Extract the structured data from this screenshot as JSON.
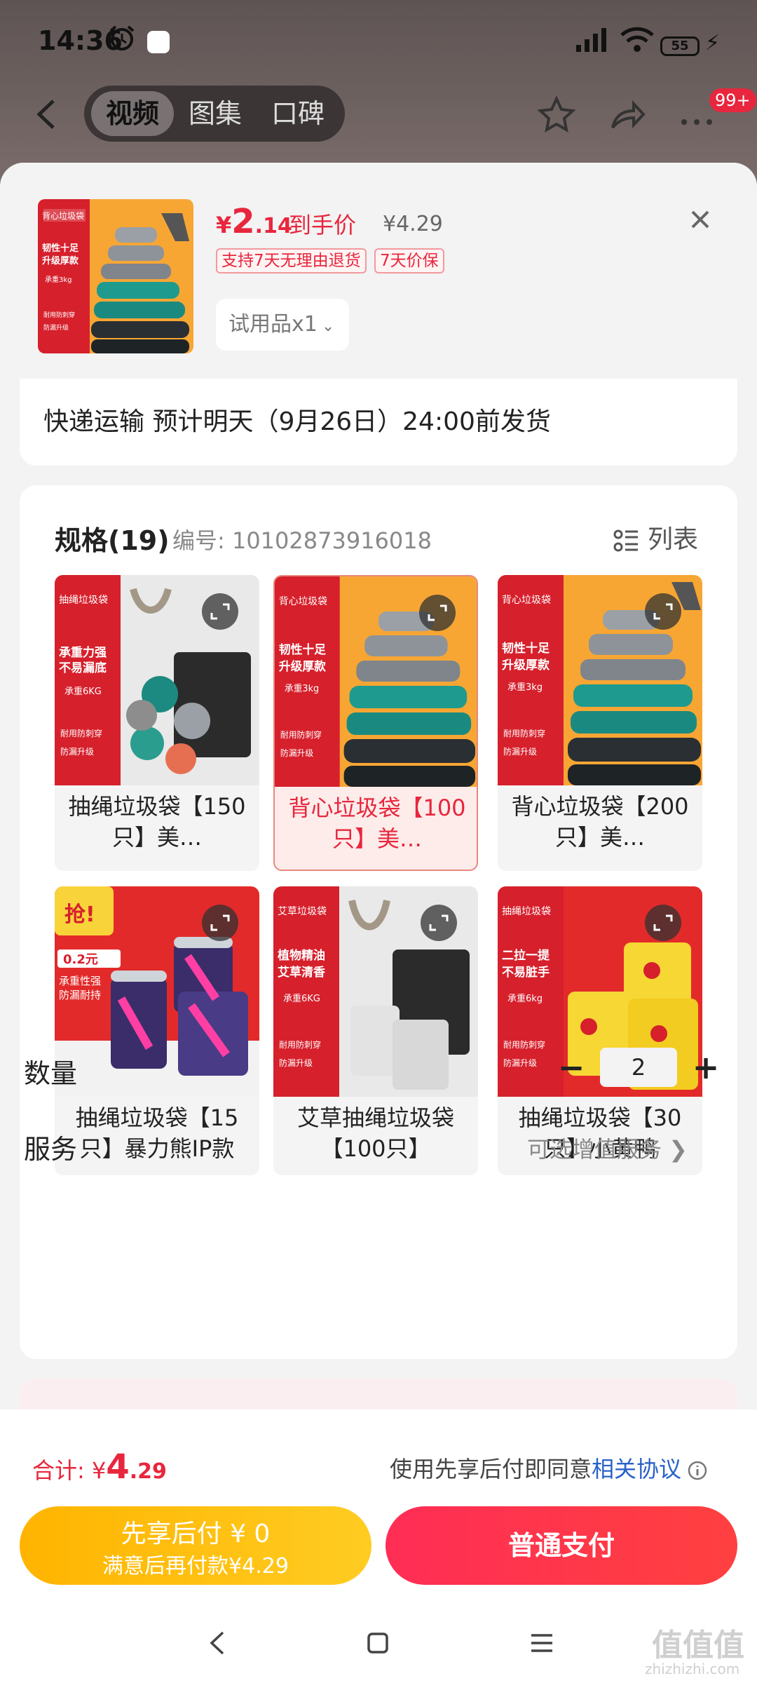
{
  "status_bar": {
    "time": "14:36",
    "battery": "55"
  },
  "top_nav": {
    "tabs": [
      {
        "label": "视频",
        "active": true
      },
      {
        "label": "图集",
        "active": false
      },
      {
        "label": "口碑",
        "active": false
      }
    ],
    "badge": "99+"
  },
  "product": {
    "currency": "¥",
    "price_int": "2",
    "price_dec": ".14",
    "price_label": "到手价",
    "original_price": "¥4.29",
    "tags": [
      "支持7天无理由退货",
      "7天价保"
    ],
    "selected_option": "试用品x1",
    "thumb_text": {
      "top": "背心垃圾袋",
      "mid": "韧性十足\n升级厚款",
      "sub": "承重3kg",
      "f1": "耐用防刺穿",
      "f2": "防漏升级"
    }
  },
  "shipping": {
    "text": "快递运输 预计明天（9月26日）24:00前发货"
  },
  "specs": {
    "title": "规格(19)",
    "code": "编号: 10102873916018",
    "list_label": "列表",
    "items": [
      {
        "caption": "抽绳垃圾袋【150只】美…",
        "banner": "抽绳垃圾袋",
        "headline": "承重力强\n不易漏底",
        "sub": "承重6KG",
        "f1": "耐用防刺穿",
        "f2": "防漏升级",
        "selected": false
      },
      {
        "caption": "背心垃圾袋【100只】美…",
        "banner": "背心垃圾袋",
        "headline": "韧性十足\n升级厚款",
        "sub": "承重3kg",
        "f1": "耐用防刺穿",
        "f2": "防漏升级",
        "selected": true
      },
      {
        "caption": "背心垃圾袋【200只】美…",
        "banner": "背心垃圾袋",
        "headline": "韧性十足\n升级厚款",
        "sub": "承重3kg",
        "f1": "耐用防刺穿",
        "f2": "防漏升级",
        "selected": false
      },
      {
        "caption": "抽绳垃圾袋【15只】暴力熊IP款",
        "banner": "抢!",
        "headline": "承重性强\n防漏耐持",
        "sub": "0.2元",
        "f1": "",
        "f2": "",
        "selected": false
      },
      {
        "caption": "艾草抽绳垃圾袋【100只】",
        "banner": "艾草垃圾袋",
        "headline": "植物精油\n艾草清香",
        "sub": "承重6KG",
        "f1": "耐用防刺穿",
        "f2": "防漏升级",
        "selected": false
      },
      {
        "caption": "抽绳垃圾袋【30只】小黄鸭",
        "banner": "抽绳垃圾袋",
        "headline": "二拉一提\n不易脏手",
        "sub": "承重6kg",
        "f1": "耐用防刺穿",
        "f2": "防漏升级",
        "selected": false
      }
    ]
  },
  "quantity": {
    "label": "数量",
    "value": "2",
    "minus": "−",
    "plus": "+"
  },
  "service": {
    "label": "服务",
    "value": "可选增值服务 ❯"
  },
  "footer": {
    "total_label": "合计:",
    "total_currency": "¥",
    "total_int": "4",
    "total_dec": ".29",
    "agree_text": "使用先享后付即同意",
    "agree_link": "相关协议",
    "later_line1": "先享后付 ¥ 0",
    "later_line2": "满意后再付款¥4.29",
    "pay_label": "普通支付"
  },
  "watermark": {
    "main": "值值值",
    "sub": "zhizhizhi.com"
  },
  "colors": {
    "accent": "#e8263d",
    "link": "#2962c9",
    "pay_button": "#ff2d55",
    "later_button": "#ffb400"
  }
}
